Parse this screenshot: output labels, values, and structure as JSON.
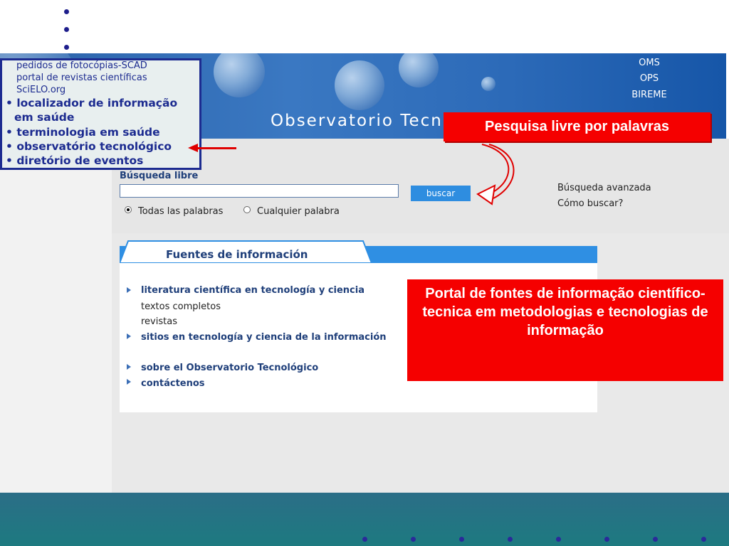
{
  "header": {
    "title": "Observatorio Tecnológico",
    "org_links": [
      "OMS",
      "OPS",
      "BIREME"
    ]
  },
  "menu_box": {
    "small_items": [
      "pedidos de fotocópias-SCAD",
      "portal de revistas científicas",
      "SciELO.org"
    ],
    "big_items": [
      "localizador de informação",
      "em saúde",
      "terminologia em saúde",
      "observatório tecnológico",
      "diretório de eventos"
    ]
  },
  "search": {
    "heading": "Búsqueda libre",
    "input_value": "",
    "button_label": "buscar",
    "options": [
      "Todas las palabras",
      "Cualquier palabra"
    ],
    "selected_option": "Todas las palabras",
    "links": [
      "Búsqueda avanzada",
      "Cómo buscar?"
    ]
  },
  "sources": {
    "tab_title": "Fuentes de información",
    "items": [
      {
        "label": "literatura científica en tecnología y ciencia"
      },
      {
        "label": "sitios en tecnología y ciencia de la información"
      },
      {
        "label": "sobre el Observatorio Tecnológico"
      },
      {
        "label": "contáctenos"
      }
    ],
    "sub_items": [
      "textos completos",
      "revistas"
    ]
  },
  "callouts": {
    "search": "Pesquisa livre por palavras",
    "sources": "Portal de fontes de informação científico-tecnica em metodologias e tecnologias de informação"
  },
  "colors": {
    "callout_red": "#f50000",
    "menu_border": "#1c2b90",
    "banner_blue": "#2b62a8",
    "tab_blue": "#2f8fe3",
    "footer_teal": "#1d7a80"
  }
}
